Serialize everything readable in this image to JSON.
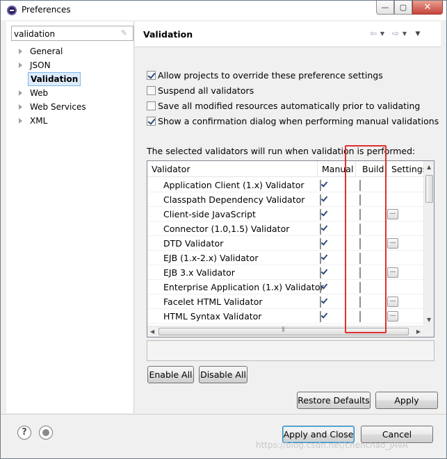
{
  "window": {
    "title": "Preferences",
    "app_icon": "eclipse-icon",
    "controls": {
      "minimize": "—",
      "maximize": "▢",
      "close": "✕"
    }
  },
  "sidebar": {
    "filter_value": "validation",
    "filter_clear_icon": "clear-filter-icon",
    "items": [
      {
        "label": "General",
        "expandable": true,
        "selected": false
      },
      {
        "label": "JSON",
        "expandable": true,
        "selected": false
      },
      {
        "label": "Validation",
        "expandable": false,
        "selected": true
      },
      {
        "label": "Web",
        "expandable": true,
        "selected": false
      },
      {
        "label": "Web Services",
        "expandable": true,
        "selected": false
      },
      {
        "label": "XML",
        "expandable": true,
        "selected": false
      }
    ]
  },
  "page": {
    "title": "Validation",
    "nav": {
      "back_icon": "⇦",
      "forward_icon": "⇨",
      "dropdown_icon": "▼",
      "menu_icon": "▼"
    },
    "options": [
      {
        "label": "Allow projects to override these preference settings",
        "checked": true
      },
      {
        "label": "Suspend all validators",
        "checked": false
      },
      {
        "label": "Save all modified resources automatically prior to validating",
        "checked": false
      },
      {
        "label": "Show a confirmation dialog when performing manual validations",
        "checked": true
      }
    ],
    "intro": "The selected validators will run when validation is performed:",
    "table": {
      "columns": {
        "validator": "Validator",
        "manual": "Manual",
        "build": "Build",
        "settings": "Settings"
      },
      "settings_label": "...",
      "rows": [
        {
          "name": "Application Client (1.x) Validator",
          "manual": true,
          "build": false,
          "settings": false
        },
        {
          "name": "Classpath Dependency Validator",
          "manual": true,
          "build": false,
          "settings": false
        },
        {
          "name": "Client-side JavaScript",
          "manual": true,
          "build": false,
          "settings": true
        },
        {
          "name": "Connector (1.0,1.5) Validator",
          "manual": true,
          "build": false,
          "settings": false
        },
        {
          "name": "DTD Validator",
          "manual": true,
          "build": false,
          "settings": true
        },
        {
          "name": "EJB (1.x-2.x) Validator",
          "manual": true,
          "build": false,
          "settings": false
        },
        {
          "name": "EJB 3.x Validator",
          "manual": true,
          "build": false,
          "settings": true
        },
        {
          "name": "Enterprise Application (1.x) Validator",
          "manual": true,
          "build": false,
          "settings": false
        },
        {
          "name": "Facelet HTML Validator",
          "manual": true,
          "build": false,
          "settings": true
        },
        {
          "name": "HTML Syntax Validator",
          "manual": true,
          "build": false,
          "settings": true
        }
      ]
    },
    "highlight_color": "#e22e2e",
    "buttons": {
      "enable_all": "Enable All",
      "disable_all": "Disable All",
      "restore_defaults": "Restore Defaults",
      "apply": "Apply"
    }
  },
  "footer": {
    "help_icon": "?",
    "apply_and_close": "Apply and Close",
    "cancel": "Cancel",
    "watermark": "https://blog.csdn.net/chenchao_JAVA"
  }
}
